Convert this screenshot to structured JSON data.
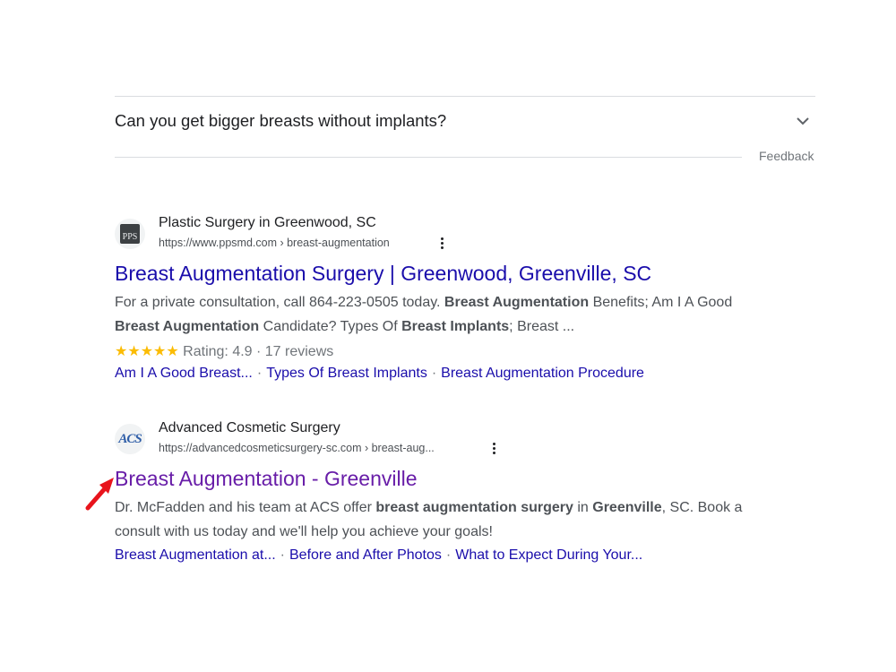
{
  "faq": {
    "question": "Can you get bigger breasts without implants?",
    "feedback": "Feedback"
  },
  "results": [
    {
      "favicon_text": "PPS",
      "site_name": "Plastic Surgery in Greenwood, SC",
      "url": "https://www.ppsmd.com › breast-augmentation",
      "title": "Breast Augmentation Surgery | Greenwood, Greenville, SC",
      "snippet_parts": [
        {
          "text": "For a private consultation, call 864-223-0505 today. ",
          "bold": false
        },
        {
          "text": "Breast Augmentation",
          "bold": true
        },
        {
          "text": " Benefits; Am I A Good ",
          "bold": false
        },
        {
          "text": "Breast Augmentation",
          "bold": true
        },
        {
          "text": " Candidate? Types Of ",
          "bold": false
        },
        {
          "text": "Breast Implants",
          "bold": true
        },
        {
          "text": "; Breast ...",
          "bold": false
        }
      ],
      "stars": "★★★★★",
      "rating_text": "Rating: 4.9 · 17 reviews",
      "rating_value": 4.9,
      "sitelinks": [
        "Am I A Good Breast...",
        "Types Of Breast Implants",
        "Breast Augmentation Procedure"
      ],
      "visited": false
    },
    {
      "favicon_text": "ACS",
      "site_name": "Advanced Cosmetic Surgery",
      "url": "https://advancedcosmeticsurgery-sc.com › breast-aug...",
      "title": "Breast Augmentation - Greenville",
      "snippet_parts": [
        {
          "text": "Dr. McFadden and his team at ACS offer ",
          "bold": false
        },
        {
          "text": "breast augmentation surgery",
          "bold": true
        },
        {
          "text": " in ",
          "bold": false
        },
        {
          "text": "Greenville",
          "bold": true
        },
        {
          "text": ", SC. Book a consult with us today and we'll help you achieve your goals!",
          "bold": false
        }
      ],
      "sitelinks": [
        "Breast Augmentation at...",
        "Before and After Photos",
        "What to Expect During Your..."
      ],
      "visited": true
    }
  ],
  "annotation": {
    "arrow_color": "#e8141c"
  },
  "colors": {
    "link": "#1a0dab",
    "visited": "#681da8",
    "star": "#fbbc04"
  }
}
